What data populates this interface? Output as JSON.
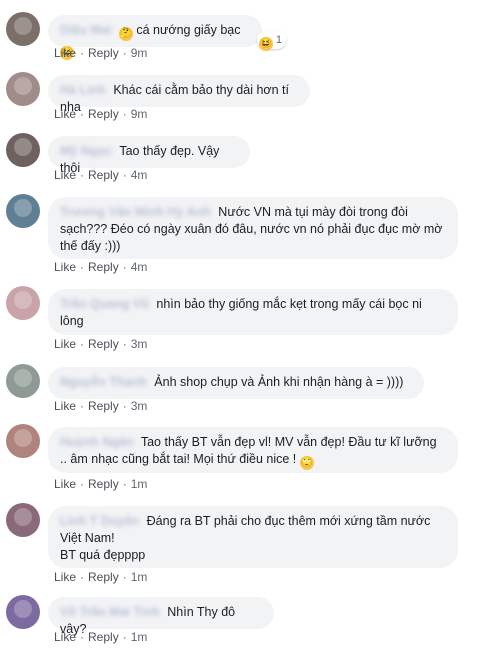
{
  "actions": {
    "like": "Like",
    "reply": "Reply",
    "separator": "·"
  },
  "comments": [
    {
      "author": "Diệu Mai",
      "avatar_color": "#7b6f6a",
      "text": "cá nướng giấy bạc",
      "time": "9m",
      "reaction_count": "1",
      "emoji_start": "🤔",
      "emoji_end": "😆"
    },
    {
      "author": "Hà Linh",
      "avatar_color": "#a08c88",
      "text": "Khác cái cằm bảo thy dài hơn tí nha",
      "time": "9m"
    },
    {
      "author": "Mỹ Ngọc",
      "avatar_color": "#6e6260",
      "text": "Tao thấy đẹp. Vậy thôi",
      "time": "4m"
    },
    {
      "author": "Trương Văn Minh Hy Anh",
      "avatar_color": "#5f7f95",
      "text": "Nước VN mà tụi mày đòi trong đòi sạch??? Đéo có ngày xuân đó đâu, nước vn nó phải đục đục mờ mờ thế đấy :)))",
      "time": "4m"
    },
    {
      "author": "Trần Quang Vũ",
      "avatar_color": "#c9a3a8",
      "text": "nhìn bảo thy giống mắc kẹt trong mấy cái bọc ni lông",
      "time": "3m"
    },
    {
      "author": "Nguyễn Thanh",
      "avatar_color": "#8f9a94",
      "text": "Ảnh shop chụp và Ảnh khi nhận hàng à = ))))",
      "time": "3m"
    },
    {
      "author": "Huỳnh Ngân",
      "avatar_color": "#b0847e",
      "text": "Tao thấy BT vẫn đẹp vl! MV vẫn đẹp! Đầu tư kĩ lưỡng .. âm nhạc cũng bắt tai! Mọi thứ điều nice !",
      "time": "1m",
      "emoji_end": "🙄"
    },
    {
      "author": "Linh T Duyên",
      "avatar_color": "#8a6a78",
      "text": "Đáng ra BT phải cho đục thêm mới xứng tầm nước Việt Nam!\nBT quá đẹpppp",
      "time": "1m"
    },
    {
      "author": "Võ Trần Mai Tinh",
      "avatar_color": "#7d6aa0",
      "text": "Nhìn Thy đô vậy?",
      "time": "1m"
    }
  ]
}
